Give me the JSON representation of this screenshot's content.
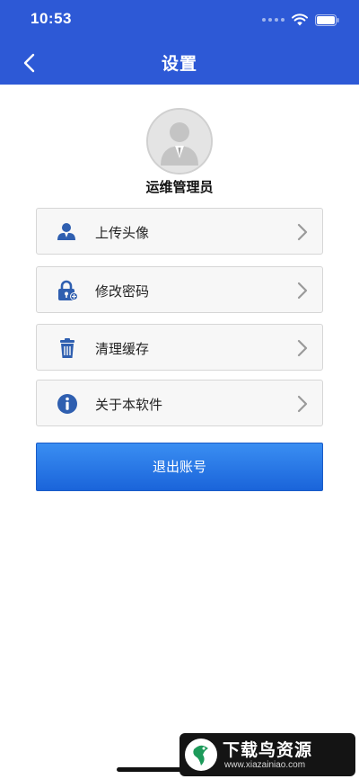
{
  "status_bar": {
    "time": "10:53"
  },
  "nav": {
    "title": "设置"
  },
  "profile": {
    "username": "运维管理员"
  },
  "menu": {
    "items": [
      {
        "label": "上传头像",
        "icon": "user-upload-icon"
      },
      {
        "label": "修改密码",
        "icon": "lock-icon"
      },
      {
        "label": "清理缓存",
        "icon": "trash-icon"
      },
      {
        "label": "关于本软件",
        "icon": "info-icon"
      }
    ]
  },
  "logout": {
    "label": "退出账号"
  },
  "watermark": {
    "title": "下载鸟资源",
    "url": "www.xiazainiao.com"
  },
  "colors": {
    "header": "#2d59d6",
    "button": "#1a64da",
    "icon": "#2f5fb0"
  }
}
